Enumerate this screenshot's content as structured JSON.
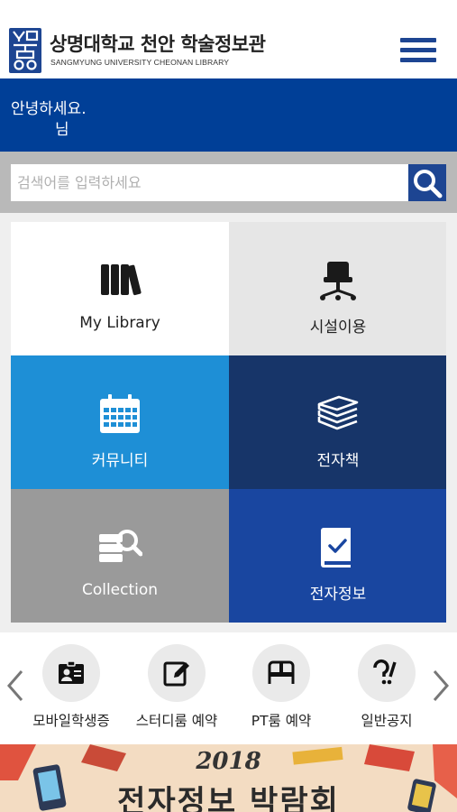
{
  "header": {
    "title": "상명대학교 천안 학술정보관",
    "subtitle": "SANGMYUNG UNIVERSITY CHEONAN LIBRARY",
    "logo_icon": "smu-logo-icon",
    "menu_icon": "hamburger-menu-icon"
  },
  "greeting": {
    "line1": "안녕하세요.",
    "line2": "님"
  },
  "search": {
    "placeholder": "검색어를 입력하세요",
    "value": "",
    "icon": "search-icon"
  },
  "tiles": [
    {
      "label": "My Library",
      "icon": "books-icon"
    },
    {
      "label": "시설이용",
      "icon": "office-chair-icon"
    },
    {
      "label": "커뮤니티",
      "icon": "calendar-icon"
    },
    {
      "label": "전자책",
      "icon": "stacked-books-icon"
    },
    {
      "label": "Collection",
      "icon": "database-search-icon"
    },
    {
      "label": "전자정보",
      "icon": "checked-book-icon"
    }
  ],
  "quick_links": [
    {
      "label": "모바일학생증",
      "icon": "id-card-icon"
    },
    {
      "label": "스터디룸 예약",
      "icon": "edit-note-icon"
    },
    {
      "label": "PT룸 예약",
      "icon": "room-door-icon"
    },
    {
      "label": "일반공지",
      "icon": "question-exclamation-icon"
    }
  ],
  "banner": {
    "year": "2018",
    "title": "전자정보 박람회"
  },
  "colors": {
    "brand_blue": "#003f97",
    "tile_sky": "#1e8fd6",
    "tile_navy": "#173569",
    "tile_gray": "#9a9a9a",
    "tile_royal": "#1946a0"
  }
}
